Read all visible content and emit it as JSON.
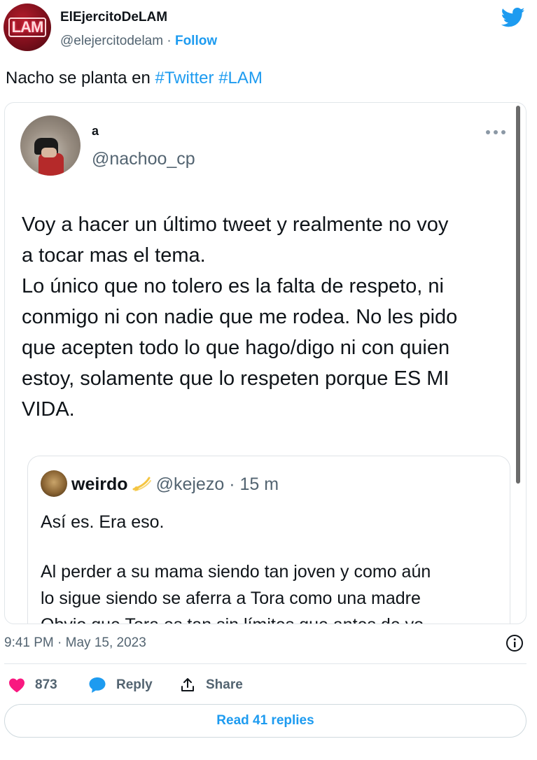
{
  "author": {
    "avatar_text": "LAM",
    "name": "ElEjercitoDeLAM",
    "handle": "@elejercitodelam",
    "separator": "·",
    "follow_label": "Follow"
  },
  "tweet": {
    "text_plain": "Nacho se planta en ",
    "hashtag1": "#Twitter",
    "hashtag2": "#LAM"
  },
  "embedded": {
    "name": "a",
    "handle": "@nachoo_cp",
    "body_lines": [
      "Voy a hacer un último tweet y realmente no voy",
      "a tocar mas el tema.",
      "Lo único que no tolero es la falta de respeto, ni",
      "conmigo ni con nadie que me rodea. No les pido",
      "que acepten todo lo que hago/digo ni con quien",
      "estoy, solamente que lo respeten porque ES MI",
      "VIDA."
    ],
    "quote": {
      "name": "weirdo",
      "handle": "@kejezo",
      "separator": "·",
      "time": "15 m",
      "line1": "Así es. Era eso.",
      "body_lines": [
        "Al perder a su mama siendo tan joven y como aún",
        "lo sigue siendo se aferra a Tora como una madre",
        "Obvio que Tora es tan sin límites que antes de yo"
      ]
    }
  },
  "footer": {
    "timestamp": "9:41 PM · May 15, 2023",
    "likes": "873",
    "reply_label": "Reply",
    "share_label": "Share",
    "read_replies_label": "Read 41 replies"
  },
  "colors": {
    "accent": "#1d9bf0",
    "like": "#f91880",
    "muted": "#536471"
  }
}
